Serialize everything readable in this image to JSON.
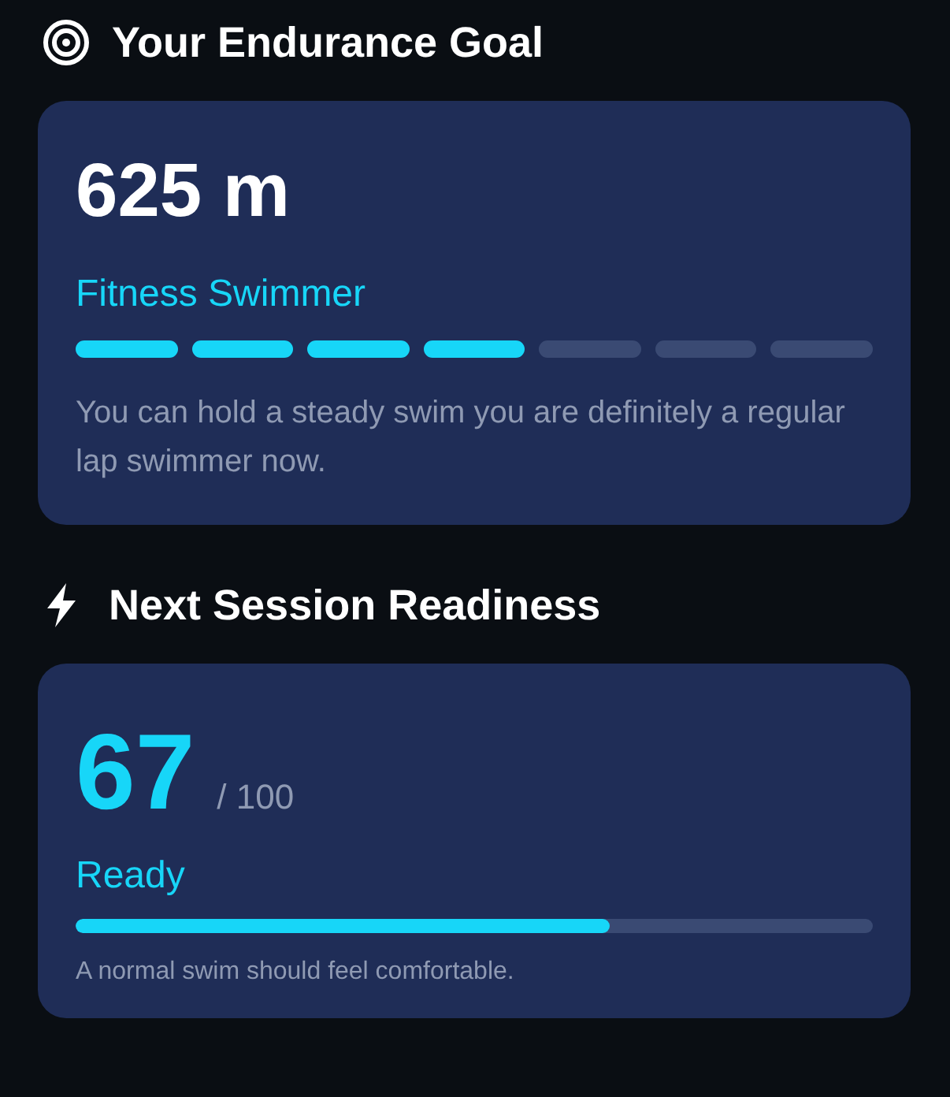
{
  "goal": {
    "title": "Your Endurance Goal",
    "distance": "625 m",
    "level_name": "Fitness Swimmer",
    "segments": [
      {
        "on": true
      },
      {
        "on": true
      },
      {
        "on": true
      },
      {
        "on": true
      },
      {
        "on": false
      },
      {
        "on": false
      },
      {
        "on": false
      }
    ],
    "description": "You can hold a steady swim you are definitely a regular lap swimmer now."
  },
  "readiness": {
    "title": "Next Session Readiness",
    "score": "67",
    "max": "/ 100",
    "status": "Ready",
    "level": 0.67,
    "note": "A normal swim should feel comfortable."
  }
}
